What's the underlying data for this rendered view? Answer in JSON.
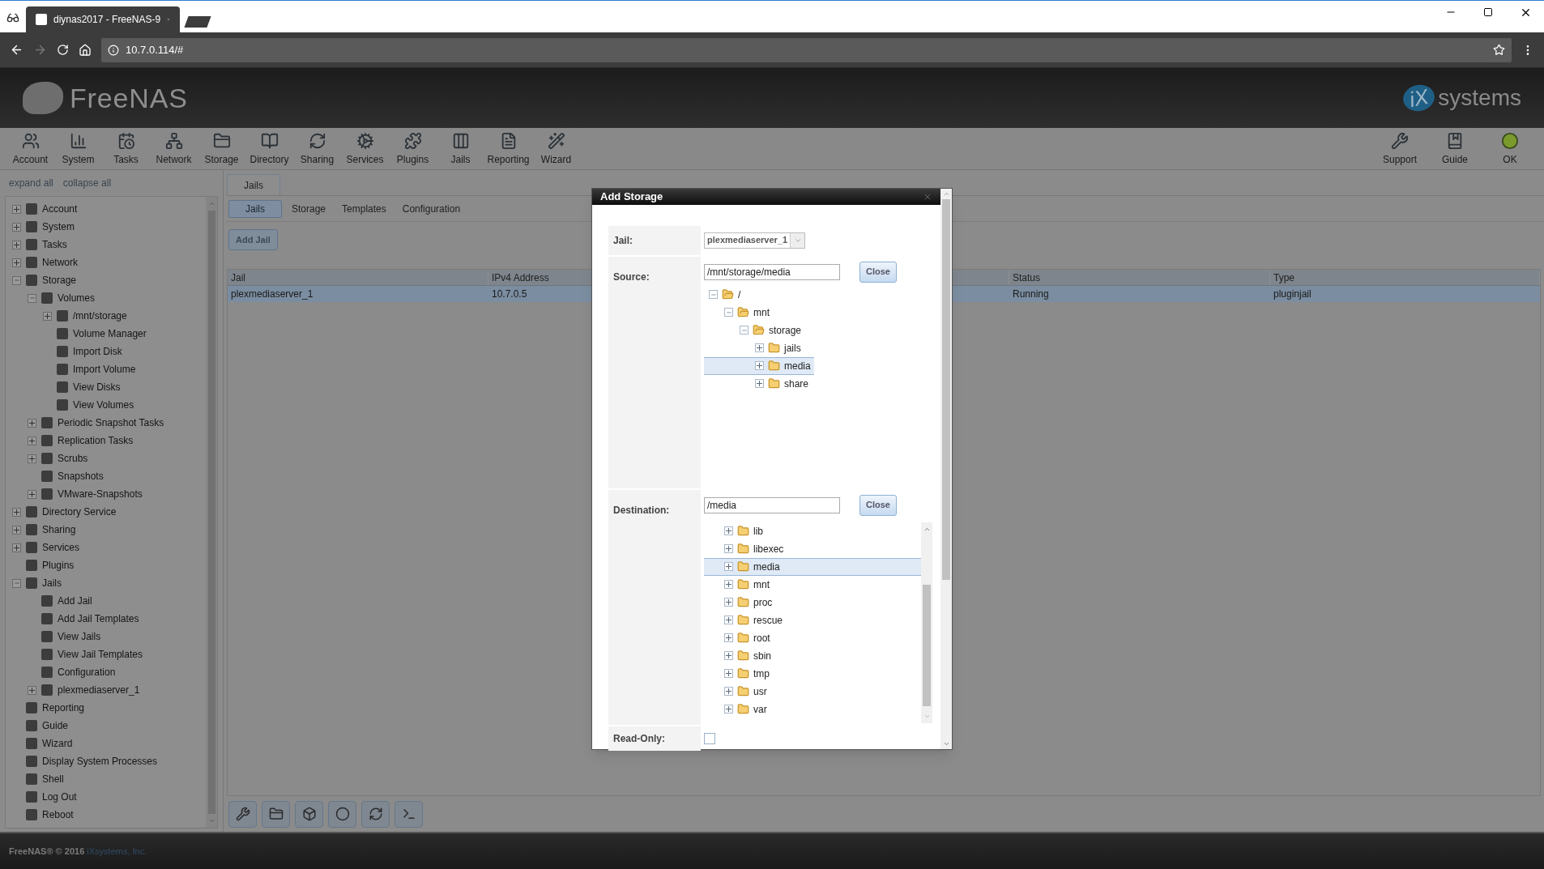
{
  "browser": {
    "tab_title": "diynas2017 - FreeNAS-9",
    "url": "10.7.0.114/#"
  },
  "header": {
    "logo": "FreeNAS",
    "brand_mark": "iX",
    "brand": "systems"
  },
  "toolbar": {
    "left": [
      "Account",
      "System",
      "Tasks",
      "Network",
      "Storage",
      "Directory",
      "Sharing",
      "Services",
      "Plugins",
      "Jails",
      "Reporting",
      "Wizard"
    ],
    "right": [
      "Support",
      "Guide",
      "OK"
    ]
  },
  "sidebar": {
    "links": [
      "expand all",
      "collapse all"
    ],
    "items": [
      {
        "label": "Account",
        "expanded": false
      },
      {
        "label": "System",
        "expanded": false
      },
      {
        "label": "Tasks",
        "expanded": false
      },
      {
        "label": "Network",
        "expanded": false
      },
      {
        "label": "Storage",
        "expanded": true,
        "children": [
          {
            "label": "Volumes",
            "expanded": true,
            "children": [
              {
                "label": "/mnt/storage",
                "expanded": false
              },
              {
                "label": "Volume Manager"
              },
              {
                "label": "Import Disk"
              },
              {
                "label": "Import Volume"
              },
              {
                "label": "View Disks"
              },
              {
                "label": "View Volumes"
              }
            ]
          },
          {
            "label": "Periodic Snapshot Tasks",
            "expanded": false
          },
          {
            "label": "Replication Tasks",
            "expanded": false
          },
          {
            "label": "Scrubs",
            "expanded": false
          },
          {
            "label": "Snapshots"
          },
          {
            "label": "VMware-Snapshots",
            "expanded": false
          }
        ]
      },
      {
        "label": "Directory Service",
        "expanded": false
      },
      {
        "label": "Sharing",
        "expanded": false
      },
      {
        "label": "Services",
        "expanded": false
      },
      {
        "label": "Plugins"
      },
      {
        "label": "Jails",
        "expanded": true,
        "children": [
          {
            "label": "Add Jail"
          },
          {
            "label": "Add Jail Templates"
          },
          {
            "label": "View Jails"
          },
          {
            "label": "View Jail Templates"
          },
          {
            "label": "Configuration"
          },
          {
            "label": "plexmediaserver_1",
            "expanded": false
          }
        ]
      },
      {
        "label": "Reporting"
      },
      {
        "label": "Guide"
      },
      {
        "label": "Wizard"
      },
      {
        "label": "Display System Processes"
      },
      {
        "label": "Shell"
      },
      {
        "label": "Log Out"
      },
      {
        "label": "Reboot"
      }
    ]
  },
  "main": {
    "tabs": [
      {
        "label": "Jails",
        "selected": true
      }
    ],
    "subtabs": [
      {
        "label": "Jails",
        "selected": true
      },
      {
        "label": "Storage",
        "selected": false
      },
      {
        "label": "Templates",
        "selected": false
      },
      {
        "label": "Configuration",
        "selected": false
      }
    ],
    "add_button": "Add Jail",
    "table": {
      "columns": [
        "Jail",
        "IPv4 Address",
        "Status",
        "Type"
      ],
      "rows": [
        {
          "cells": [
            "plexmediaserver_1",
            "10.7.0.5",
            "Running",
            "pluginjail"
          ],
          "selected": true
        }
      ]
    }
  },
  "footer": {
    "text": "FreeNAS® © 2016 ",
    "link": "iXsystems, Inc."
  },
  "dialog": {
    "title": "Add Storage",
    "jail": {
      "label": "Jail:",
      "value": "plexmediaserver_1"
    },
    "source": {
      "label": "Source:",
      "value": "/mnt/storage/media",
      "button": "Close",
      "tree": [
        {
          "label": "/",
          "expanded": true,
          "selected": false,
          "children": [
            {
              "label": "mnt",
              "expanded": true,
              "selected": false,
              "children": [
                {
                  "label": "storage",
                  "expanded": true,
                  "selected": false,
                  "children": [
                    {
                      "label": "jails",
                      "expanded": false,
                      "selected": false
                    },
                    {
                      "label": "media",
                      "expanded": false,
                      "selected": true
                    },
                    {
                      "label": "share",
                      "expanded": false,
                      "selected": false
                    }
                  ]
                }
              ]
            }
          ]
        }
      ]
    },
    "destination": {
      "label": "Destination:",
      "value": "/media",
      "button": "Close",
      "tree": [
        {
          "label": "lib",
          "selected": false
        },
        {
          "label": "libexec",
          "selected": false
        },
        {
          "label": "media",
          "selected": true
        },
        {
          "label": "mnt",
          "selected": false
        },
        {
          "label": "proc",
          "selected": false
        },
        {
          "label": "rescue",
          "selected": false
        },
        {
          "label": "root",
          "selected": false
        },
        {
          "label": "sbin",
          "selected": false
        },
        {
          "label": "tmp",
          "selected": false
        },
        {
          "label": "usr",
          "selected": false
        },
        {
          "label": "var",
          "selected": false
        }
      ]
    },
    "read_only": {
      "label": "Read-Only:",
      "checked": false
    }
  }
}
